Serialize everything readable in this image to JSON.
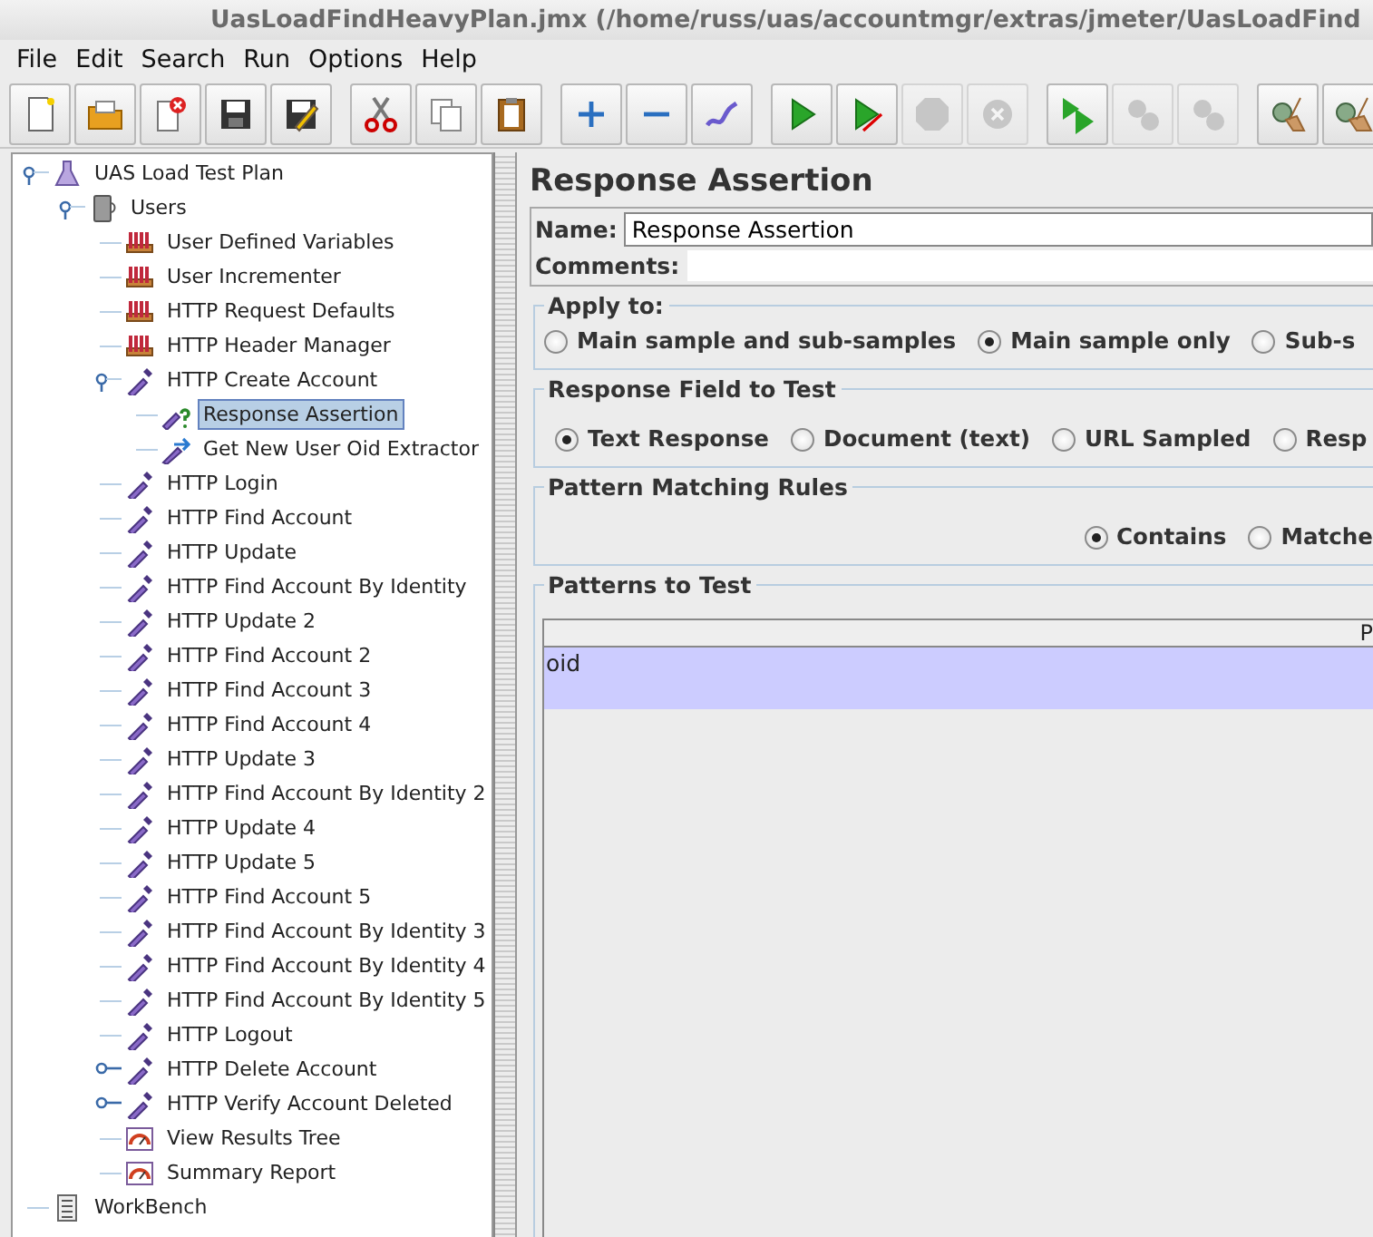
{
  "window": {
    "title": "UasLoadFindHeavyPlan.jmx (/home/russ/uas/accountmgr/extras/jmeter/UasLoadFind"
  },
  "menu": [
    "File",
    "Edit",
    "Search",
    "Run",
    "Options",
    "Help"
  ],
  "toolbar": [
    [
      {
        "kind": "new",
        "disabled": false
      },
      {
        "kind": "open",
        "disabled": false
      },
      {
        "kind": "close",
        "disabled": false
      },
      {
        "kind": "save",
        "disabled": false
      },
      {
        "kind": "save-as",
        "disabled": false
      }
    ],
    [
      {
        "kind": "cut",
        "disabled": false
      },
      {
        "kind": "copy",
        "disabled": false
      },
      {
        "kind": "paste",
        "disabled": false
      }
    ],
    [
      {
        "kind": "expand",
        "disabled": false
      },
      {
        "kind": "collapse",
        "disabled": false
      },
      {
        "kind": "toggle",
        "disabled": false
      }
    ],
    [
      {
        "kind": "start",
        "disabled": false
      },
      {
        "kind": "start-no-pause",
        "disabled": false
      },
      {
        "kind": "stop",
        "disabled": true
      },
      {
        "kind": "shutdown",
        "disabled": true
      }
    ],
    [
      {
        "kind": "remote-start",
        "disabled": false
      },
      {
        "kind": "remote-stop",
        "disabled": true
      },
      {
        "kind": "remote-shutdown",
        "disabled": true
      }
    ],
    [
      {
        "kind": "clear",
        "disabled": false
      },
      {
        "kind": "clear-all",
        "disabled": false
      }
    ]
  ],
  "tree": [
    {
      "label": "UAS Load Test Plan",
      "kind": "plan",
      "selected": false,
      "expanded": true,
      "children": [
        {
          "label": "Users",
          "kind": "thread-group",
          "selected": false,
          "expanded": true,
          "children": [
            {
              "label": "User Defined Variables",
              "kind": "config",
              "selected": false
            },
            {
              "label": "User Incrementer",
              "kind": "config",
              "selected": false
            },
            {
              "label": "HTTP Request Defaults",
              "kind": "config",
              "selected": false
            },
            {
              "label": "HTTP Header Manager",
              "kind": "config",
              "selected": false
            },
            {
              "label": "HTTP Create Account",
              "kind": "sampler",
              "selected": false,
              "expanded": true,
              "children": [
                {
                  "label": "Response Assertion",
                  "kind": "assertion",
                  "selected": true
                },
                {
                  "label": "Get New User Oid Extractor",
                  "kind": "extractor",
                  "selected": false
                }
              ]
            },
            {
              "label": "HTTP Login",
              "kind": "sampler",
              "selected": false
            },
            {
              "label": "HTTP Find Account",
              "kind": "sampler",
              "selected": false
            },
            {
              "label": "HTTP Update",
              "kind": "sampler",
              "selected": false
            },
            {
              "label": "HTTP Find Account By Identity",
              "kind": "sampler",
              "selected": false
            },
            {
              "label": "HTTP Update 2",
              "kind": "sampler",
              "selected": false
            },
            {
              "label": "HTTP Find Account 2",
              "kind": "sampler",
              "selected": false
            },
            {
              "label": "HTTP Find Account 3",
              "kind": "sampler",
              "selected": false
            },
            {
              "label": "HTTP Find Account 4",
              "kind": "sampler",
              "selected": false
            },
            {
              "label": "HTTP Update 3",
              "kind": "sampler",
              "selected": false
            },
            {
              "label": "HTTP Find Account By Identity 2",
              "kind": "sampler",
              "selected": false
            },
            {
              "label": "HTTP Update 4",
              "kind": "sampler",
              "selected": false
            },
            {
              "label": "HTTP Update 5",
              "kind": "sampler",
              "selected": false
            },
            {
              "label": "HTTP Find Account 5",
              "kind": "sampler",
              "selected": false
            },
            {
              "label": "HTTP Find Account By Identity 3",
              "kind": "sampler",
              "selected": false
            },
            {
              "label": "HTTP Find Account By Identity 4",
              "kind": "sampler",
              "selected": false
            },
            {
              "label": "HTTP Find Account By Identity 5",
              "kind": "sampler",
              "selected": false
            },
            {
              "label": "HTTP Logout",
              "kind": "sampler",
              "selected": false
            },
            {
              "label": "HTTP Delete Account",
              "kind": "sampler",
              "selected": false,
              "expanded": false
            },
            {
              "label": "HTTP Verify Account Deleted",
              "kind": "sampler",
              "selected": false,
              "expanded": false
            },
            {
              "label": "View Results Tree",
              "kind": "listener",
              "selected": false
            },
            {
              "label": "Summary Report",
              "kind": "listener",
              "selected": false
            }
          ]
        }
      ]
    },
    {
      "label": "WorkBench",
      "kind": "workbench",
      "selected": false
    }
  ],
  "editor": {
    "title": "Response Assertion",
    "name_label": "Name:",
    "name_value": "Response Assertion",
    "comments_label": "Comments:",
    "groups": [
      {
        "title": "Apply to:",
        "right_aligned": false,
        "options": [
          {
            "label": "Main sample and sub-samples",
            "selected": false
          },
          {
            "label": "Main sample only",
            "selected": true
          },
          {
            "label": "Sub-s",
            "selected": false
          }
        ]
      },
      {
        "title": "Response Field to Test",
        "right_aligned": false,
        "options": [
          {
            "label": "Text Response",
            "selected": true
          },
          {
            "label": "Document (text)",
            "selected": false
          },
          {
            "label": "URL Sampled",
            "selected": false
          },
          {
            "label": "Resp",
            "selected": false
          }
        ]
      },
      {
        "title": "Pattern Matching Rules",
        "right_aligned": true,
        "options": [
          {
            "label": "Contains",
            "selected": true
          },
          {
            "label": "Matche",
            "selected": false
          }
        ]
      }
    ],
    "patterns": {
      "title": "Patterns to Test",
      "column": "P",
      "rows": [
        {
          "value": "oid",
          "selected": true
        }
      ]
    }
  }
}
